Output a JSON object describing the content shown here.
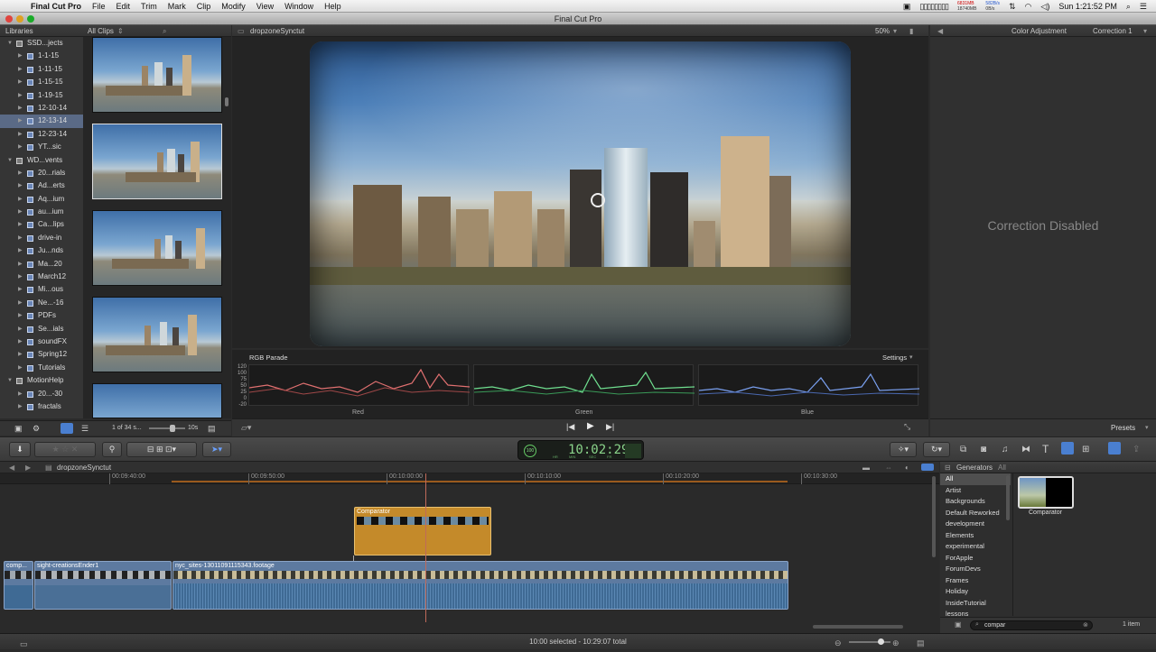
{
  "menubar": {
    "app_name": "Final Cut Pro",
    "menus": [
      "File",
      "Edit",
      "Trim",
      "Mark",
      "Clip",
      "Modify",
      "View",
      "Window",
      "Help"
    ],
    "mem_top": "6831MB",
    "mem_bottom": "18740MB",
    "net_top": "582B/s",
    "net_bottom": "0B/s",
    "clock": "Sun 1:21:52 PM"
  },
  "window": {
    "title": "Final Cut Pro"
  },
  "libraries": {
    "header": "Libraries",
    "items": [
      {
        "label": "SSD...jects",
        "level": 0,
        "expanded": true
      },
      {
        "label": "1-1-15",
        "level": 1
      },
      {
        "label": "1-11-15",
        "level": 1
      },
      {
        "label": "1-15-15",
        "level": 1
      },
      {
        "label": "1-19-15",
        "level": 1
      },
      {
        "label": "12-10-14",
        "level": 1
      },
      {
        "label": "12-13-14",
        "level": 1,
        "selected": true
      },
      {
        "label": "12-23-14",
        "level": 1
      },
      {
        "label": "YT...sic",
        "level": 1
      },
      {
        "label": "WD...vents",
        "level": 0,
        "expanded": true
      },
      {
        "label": "20...rials",
        "level": 1
      },
      {
        "label": "Ad...erts",
        "level": 1
      },
      {
        "label": "Aq...ium",
        "level": 1
      },
      {
        "label": "au...ium",
        "level": 1
      },
      {
        "label": "Ca...lips",
        "level": 1
      },
      {
        "label": "drive-in",
        "level": 1
      },
      {
        "label": "Ju...nds",
        "level": 1
      },
      {
        "label": "Ma...20",
        "level": 1
      },
      {
        "label": "March12",
        "level": 1
      },
      {
        "label": "Mi...ous",
        "level": 1
      },
      {
        "label": "Ne...-16",
        "level": 1
      },
      {
        "label": "PDFs",
        "level": 1
      },
      {
        "label": "Se...ials",
        "level": 1
      },
      {
        "label": "soundFX",
        "level": 1
      },
      {
        "label": "Spring12",
        "level": 1
      },
      {
        "label": "Tutorials",
        "level": 1
      },
      {
        "label": "MotionHelp",
        "level": 0,
        "expanded": true
      },
      {
        "label": "20...-30",
        "level": 1
      },
      {
        "label": "fractals",
        "level": 1
      }
    ]
  },
  "browser": {
    "filter": "All Clips",
    "count": "1 of 34 s...",
    "duration": "10s"
  },
  "viewer": {
    "title": "dropzoneSynctut",
    "zoom": "50%"
  },
  "scopes": {
    "title": "RGB Parade",
    "settings": "Settings",
    "scale": [
      "120",
      "100",
      "75",
      "50",
      "25",
      "0",
      "-20"
    ],
    "channels": [
      "Red",
      "Green",
      "Blue"
    ]
  },
  "inspector": {
    "title": "Color Adjustment",
    "correction": "Correction 1",
    "message": "Correction Disabled",
    "presets": "Presets"
  },
  "timecode": {
    "value": "10:02:29",
    "labels": [
      "HR",
      "MIN",
      "SEC",
      "FR"
    ],
    "badge": "100"
  },
  "timeline": {
    "project": "dropzoneSynctut",
    "ruler": [
      "00:09:40:00",
      "00:09:50:00",
      "00:10:00:00",
      "00:10:10:00",
      "00:10:20:00",
      "00:10:30:00"
    ],
    "clips": {
      "connected": "Comparator",
      "primary_1": "comp...",
      "primary_2": "sight-creationsEnder1",
      "primary_3": "nyc_sites-13011091115343.footage"
    }
  },
  "generators": {
    "header": "Generators",
    "header_all": "All",
    "categories": [
      "All",
      "Artist",
      "Backgrounds",
      "Default Reworked",
      "development",
      "Elements",
      "experimental",
      "ForApple",
      "ForumDevs",
      "Frames",
      "Holiday",
      "InsideTutorial",
      "lessons"
    ],
    "selected_category": "All",
    "result_name": "Comparator",
    "search_value": "compar",
    "count": "1 item"
  },
  "status": {
    "text": "10:00 selected - 10:29:07 total"
  },
  "colors": {
    "accent": "#4a7fd0",
    "clip_blue": "#5d7aa0",
    "clip_orange": "#c48a2a"
  }
}
